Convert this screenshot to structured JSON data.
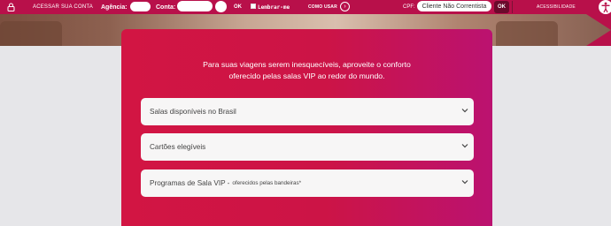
{
  "topbar": {
    "login_label": "ACESSAR SUA CONTA",
    "agencia_label": "Agência:",
    "conta_label": "Conta:",
    "ok_label": "OK",
    "remember_label": "Lembrar-me",
    "como_usar_label": "COMO USAR",
    "cpf_label": "CPF:",
    "cpf_select_value": "Cliente Não Correntista",
    "cpf_ok_label": "OK",
    "accessibility_label": "ACESSIBILIDADE"
  },
  "main": {
    "intro_line1": "Para suas viagens serem inesquecíveis, aproveite o conforto",
    "intro_line2": "oferecido pelas salas VIP ao redor do mundo.",
    "accordions": [
      {
        "title": "Salas disponíveis no Brasil",
        "subtitle": ""
      },
      {
        "title": "Cartões elegíveis",
        "subtitle": ""
      },
      {
        "title": "Programas de Sala VIP - ",
        "subtitle": "oferecidos pelas bandeiras*"
      }
    ]
  },
  "colors": {
    "topbar": "#b8104a",
    "panel_start": "#d21543",
    "panel_end": "#bb1270",
    "page_bg": "#e6e6e9"
  },
  "icons": {
    "login": "lock-icon",
    "como_usar": "chevron-right-icon",
    "accessibility": "accessibility-icon",
    "accordion": "chevron-down-icon"
  }
}
